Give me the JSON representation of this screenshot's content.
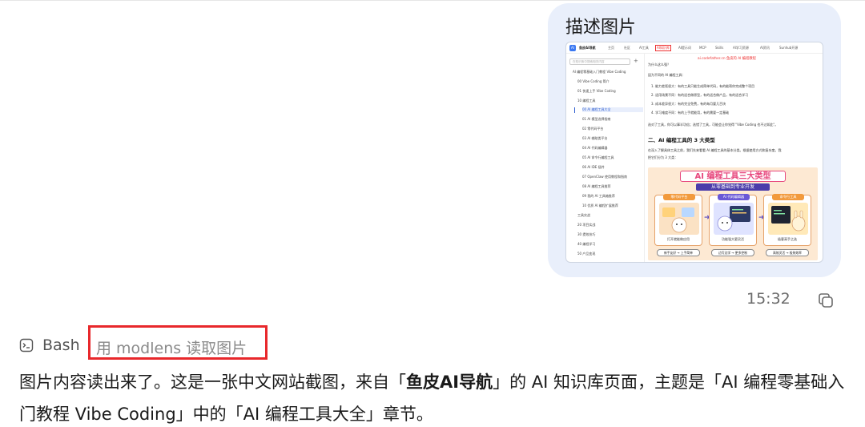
{
  "bubble": {
    "title": "描述图片"
  },
  "site": {
    "brand": "鱼皮AI导航",
    "logo": "AI",
    "nav": [
      "主页",
      "社区",
      "AI工具",
      "AI知识库",
      "AI提示词",
      "MCP",
      "Skills",
      "AI学习资源",
      "AI资讯",
      "Sunhub开源"
    ],
    "active_nav": "AI知识库",
    "search_placeholder": "在知识库中搜索相关内容",
    "sidebar": [
      "AI 编程零基础入门教程 Vibe Coding",
      "00 Vibe Coding 简介",
      "01 快速上手 Vibe Coding",
      "10 编程工具",
      "00 AI 编程工具大全",
      "01 AI 模型选择指南",
      "02 零代码平台",
      "03 AI 辅助类平台",
      "04 AI 代码编辑器",
      "05 AI 命令行编程工具",
      "06 AI IDE 插件",
      "07 OpenClaw 使用教程和指南",
      "08 AI 编程工具推荐",
      "09 我的 AI 工具箱推荐",
      "10 优质 AI 编程扩展推荐",
      "工具实战",
      "20 项目实战",
      "30 提效技巧",
      "40 编程学习",
      "50 产品变现"
    ],
    "main": {
      "link": "ai.codefather.cn 鱼皮的 AI 编程教程",
      "lines": [
        "为什么这么强？",
        "因为不同的 AI 编程工具：",
        "1. 能力差距很大：有的工具只能生成简单代码，有的能帮你完成整个项目",
        "2. 适用场景不同：有的适合做原型，有的适合做产品，有的适合学习",
        "3. 成本差异很大：有的完全免费，有的每月要几百块",
        "4. 学习难度不同：有的上手就能用，有的需要一定基础",
        "选对了工具，你可以事半功倍；选错了工具，可能会让你觉得 \"Vibe Coding 也不过如此\"。"
      ],
      "h2": "二、AI 编程工具的 3 大类型",
      "para": [
        "在深入了解具体工具之前，我们先来看看 AI 编程工具的基本分类。根据使用方式和复杂度，我",
        "把它们分为 3 大类："
      ]
    },
    "poster": {
      "title": "AI 编程工具三大类型",
      "subtitle": "从零基础到专业开发",
      "cards": [
        {
          "title": "零代码平台",
          "caption": "打开就能做应用",
          "footer": "新手友好 → 上手简单",
          "color": "#f29a3c"
        },
        {
          "title": "AI 代码编辑器",
          "caption": "功能强大更灵活",
          "footer": "边写边学 → 更多控制",
          "color": "#6a58d6"
        },
        {
          "title": "命令行工具",
          "caption": "极客高手之选",
          "footer": "高效灵活 → 极致效率",
          "color": "#f29a3c"
        }
      ]
    }
  },
  "meta": {
    "time": "15:32"
  },
  "tool": {
    "name": "Bash",
    "command": "用 modlens 读取图片"
  },
  "message": {
    "p1": "图片内容读出来了。这是一张中文网站截图，来自「",
    "bold": "鱼皮AI导航",
    "p2": "」的 AI 知识库页面，主题是「AI 编程零基础入门教程 Vibe Coding」中的「AI 编程工具大全」章节。"
  }
}
